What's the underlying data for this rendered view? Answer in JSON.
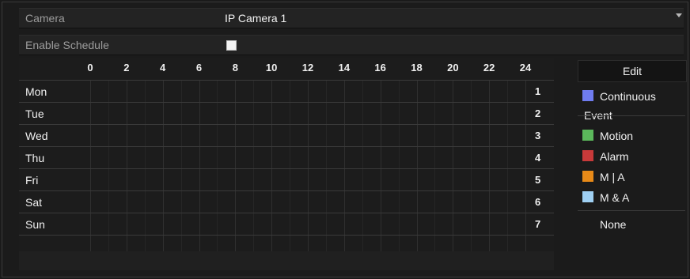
{
  "camera": {
    "label": "Camera",
    "value": "IP Camera 1"
  },
  "schedule": {
    "label": "Enable Schedule",
    "enabled": true
  },
  "grid": {
    "hours": [
      "0",
      "2",
      "4",
      "6",
      "8",
      "10",
      "12",
      "14",
      "16",
      "18",
      "20",
      "22",
      "24"
    ],
    "days": [
      {
        "label": "Mon",
        "num": "1"
      },
      {
        "label": "Tue",
        "num": "2"
      },
      {
        "label": "Wed",
        "num": "3"
      },
      {
        "label": "Thu",
        "num": "4"
      },
      {
        "label": "Fri",
        "num": "5"
      },
      {
        "label": "Sat",
        "num": "6"
      },
      {
        "label": "Sun",
        "num": "7"
      }
    ]
  },
  "panel": {
    "edit_label": "Edit",
    "continuous_label": "Continuous",
    "event_label": "Event",
    "legend": [
      {
        "label": "Motion",
        "color": "#5bb85b"
      },
      {
        "label": "Alarm",
        "color": "#c83a3a"
      },
      {
        "label": "M | A",
        "color": "#e88a18"
      },
      {
        "label": "M & A",
        "color": "#9fd0f3"
      }
    ],
    "none_label": "None",
    "continuous_color": "#6f7cf0"
  }
}
